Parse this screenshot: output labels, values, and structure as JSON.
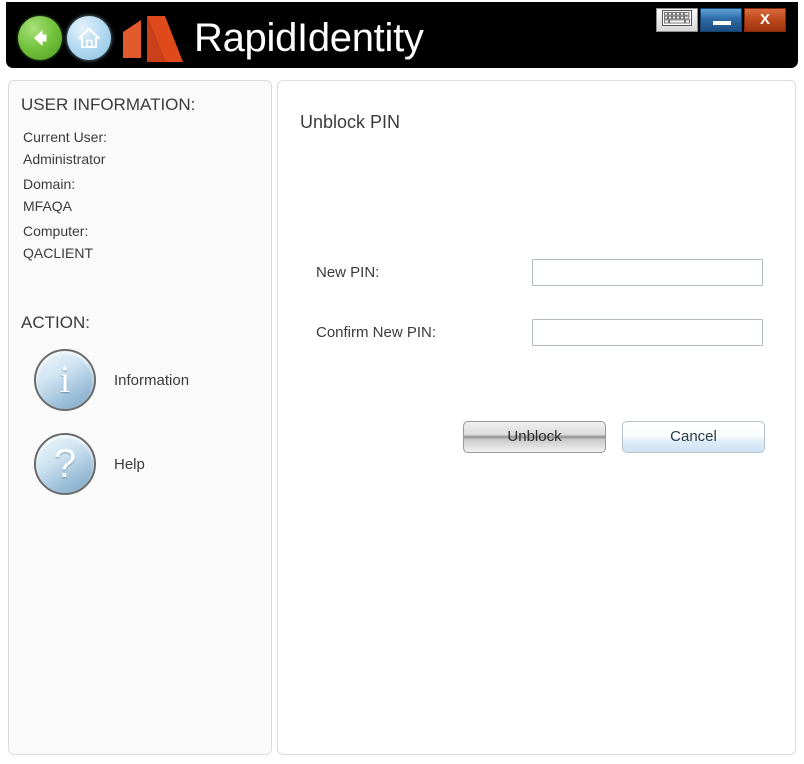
{
  "window": {
    "app_title": "RapidIdentity",
    "logo_color": "#df5024",
    "titlebar_bg": "#000000",
    "controls": {
      "keyboard_label": "keyboard-icon",
      "minimize_label": "",
      "close_label": "X",
      "minimize_color": "#2d6ba6",
      "close_color": "#bf4a1c"
    },
    "nav": {
      "back_label": "back-arrow-icon",
      "back_color": "#72c23c",
      "home_label": "home-icon",
      "home_color": "#b6dbf1"
    }
  },
  "sidebar": {
    "user_information_heading": "USER INFORMATION:",
    "fields": [
      {
        "label": "Current User:",
        "value": "Administrator"
      },
      {
        "label": "Domain:",
        "value": "MFAQA"
      },
      {
        "label": "Computer:",
        "value": "QACLIENT"
      }
    ],
    "action_heading": "ACTION:",
    "actions": [
      {
        "label": "Information",
        "icon": "info-icon",
        "glyph": "i"
      },
      {
        "label": "Help",
        "icon": "help-icon",
        "glyph": "?"
      }
    ]
  },
  "main": {
    "title": "Unblock PIN",
    "fields": [
      {
        "label": "New PIN:",
        "value": "",
        "placeholder": ""
      },
      {
        "label": "Confirm New PIN:",
        "value": "",
        "placeholder": ""
      }
    ],
    "buttons": {
      "primary": "Unblock",
      "secondary": "Cancel"
    }
  }
}
